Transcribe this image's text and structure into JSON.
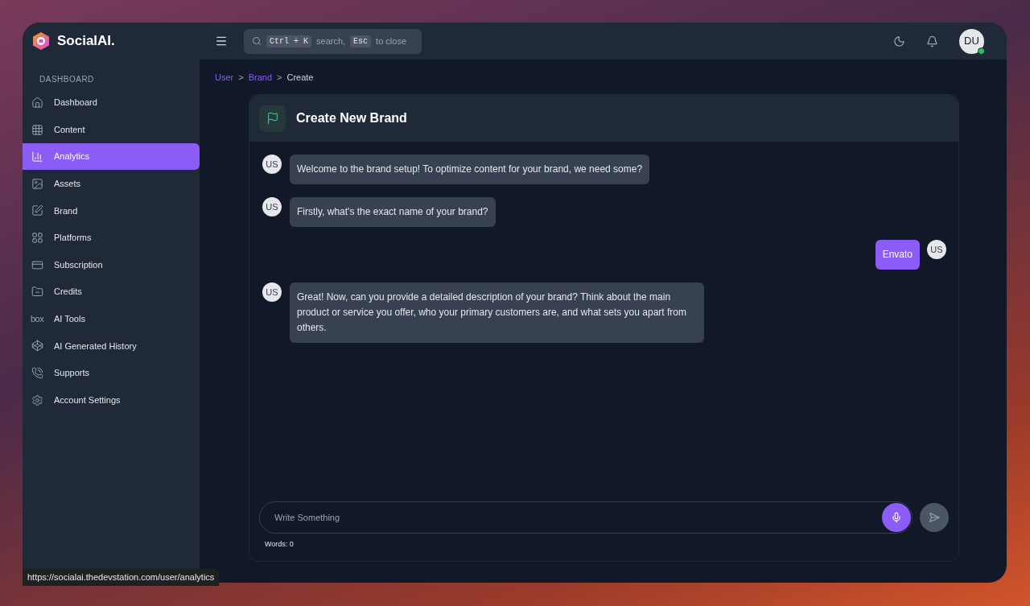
{
  "brand": {
    "name": "SocialAI."
  },
  "search": {
    "shortcut_key": "Ctrl + K",
    "shortcut_text": "search,",
    "escape_key": "Esc",
    "escape_text": "to close"
  },
  "user": {
    "initials": "DU",
    "online": true
  },
  "sidebar": {
    "section": "DASHBOARD",
    "items": [
      {
        "label": "Dashboard",
        "selected": false
      },
      {
        "label": "Content",
        "selected": false
      },
      {
        "label": "Analytics",
        "selected": true
      },
      {
        "label": "Assets",
        "selected": false
      },
      {
        "label": "Brand",
        "selected": false
      },
      {
        "label": "Platforms",
        "selected": false
      },
      {
        "label": "Subscription",
        "selected": false
      },
      {
        "label": "Credits",
        "selected": false
      },
      {
        "label": "AI Tools",
        "logo_text": "box",
        "selected": false
      },
      {
        "label": "AI Generated History",
        "selected": false
      },
      {
        "label": "Supports",
        "selected": false
      },
      {
        "label": "Account Settings",
        "selected": false
      }
    ]
  },
  "breadcrumb": [
    {
      "label": "User",
      "link": true
    },
    {
      "label": "Brand",
      "link": true
    },
    {
      "label": "Create",
      "link": false
    }
  ],
  "breadcrumb_separator": ">",
  "panel": {
    "title": "Create New Brand",
    "messages": [
      {
        "kind": "bot",
        "avatar": "US",
        "text": "Welcome to the brand setup! To optimize content for your brand, we need some?"
      },
      {
        "kind": "bot",
        "avatar": "US",
        "text": "Firstly, what's the exact name of your brand?"
      },
      {
        "kind": "user",
        "avatar": "US",
        "text": "Envato"
      },
      {
        "kind": "bot",
        "avatar": "US",
        "text": "Great! Now, can you provide a detailed description of your brand? Think about the main product or service you offer, who your primary customers are, and what sets you apart from others."
      }
    ],
    "input": {
      "placeholder": "Write Something"
    },
    "word_count": "Words: 0"
  },
  "status_url": "https://socialai.thedevstation.com/user/analytics"
}
